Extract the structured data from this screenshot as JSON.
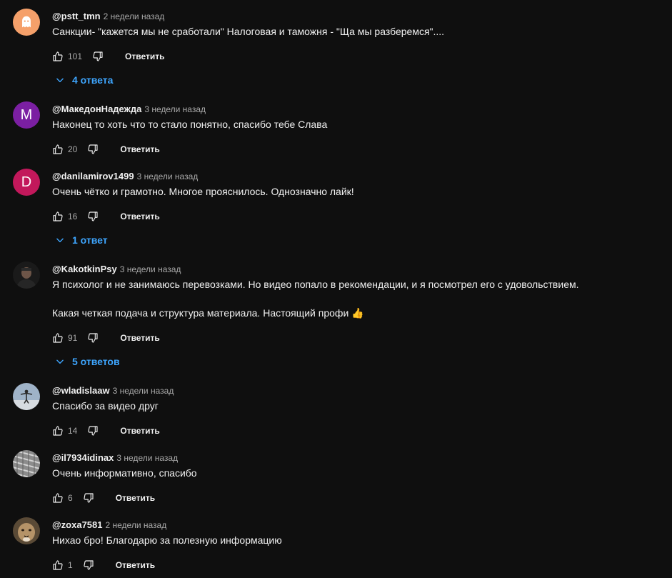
{
  "colors": {
    "background": "#0f0f0f",
    "text": "#f1f1f1",
    "muted": "#aaaaaa",
    "link": "#3ea6ff"
  },
  "reply_label": "Ответить",
  "comments": [
    {
      "author": "@pstt_tmn",
      "time": "2 недели назад",
      "lines": [
        "Санкции- \"кажется мы не сработали\" Налоговая и таможня - \"Ща мы разберемся\"...."
      ],
      "likes": "101",
      "replies": "4 ответа",
      "avatar": {
        "type": "icon",
        "icon": "ghost-icon",
        "bg": "#f5a06a"
      }
    },
    {
      "author": "@МакедонНадежда",
      "time": "3 недели назад",
      "lines": [
        "Наконец то хоть что то стало понятно, спасибо тебе Слава"
      ],
      "likes": "20",
      "avatar": {
        "type": "letter",
        "letter": "M",
        "bg": "#7b1fa2"
      }
    },
    {
      "author": "@danilamirov1499",
      "time": "3 недели назад",
      "lines": [
        "Очень чётко и грамотно. Многое прояснилось. Однозначно лайк!"
      ],
      "likes": "16",
      "replies": "1 ответ",
      "avatar": {
        "type": "letter",
        "letter": "D",
        "bg": "#c2185b"
      }
    },
    {
      "author": "@KakotkinPsy",
      "time": "3 недели назад",
      "lines": [
        "Я психолог и не занимаюсь перевозками. Но видео попало в рекомендации, и я посмотрел его с удовольствием.",
        "Какая четкая подача и структура материала. Настоящий профи 👍"
      ],
      "likes": "91",
      "replies": "5 ответов",
      "avatar": {
        "type": "photo",
        "icon": "person-photo-avatar"
      }
    },
    {
      "author": "@wladislaaw",
      "time": "3 недели назад",
      "lines": [
        "Спасибо за видео друг"
      ],
      "likes": "14",
      "avatar": {
        "type": "photo",
        "icon": "landscape-photo-avatar"
      }
    },
    {
      "author": "@il7934idinax",
      "time": "3 недели назад",
      "lines": [
        "Очень информативно, спасибо"
      ],
      "likes": "6",
      "avatar": {
        "type": "photo",
        "icon": "pattern-photo-avatar"
      }
    },
    {
      "author": "@zoxa7581",
      "time": "2 недели назад",
      "lines": [
        "Нихао бро! Благодарю за полезную информацию"
      ],
      "likes": "1",
      "avatar": {
        "type": "photo",
        "icon": "animal-photo-avatar"
      }
    }
  ]
}
